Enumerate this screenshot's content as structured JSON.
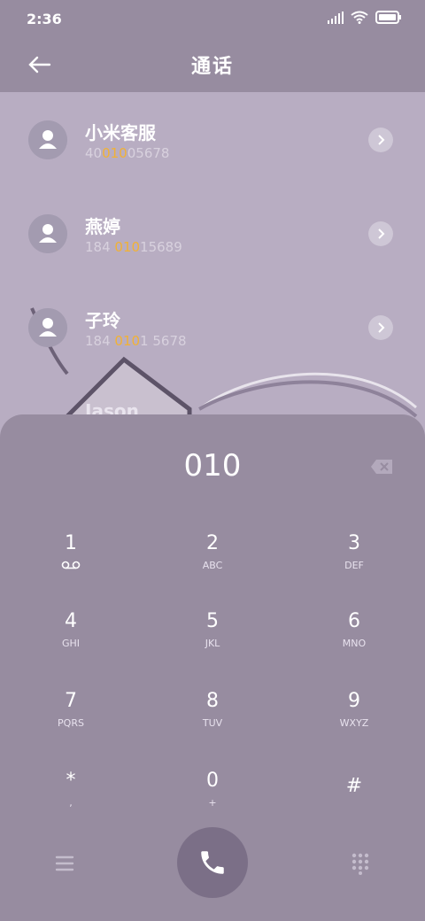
{
  "status": {
    "time": "2:36"
  },
  "header": {
    "title": "通话"
  },
  "contacts": [
    {
      "name": "小米客服",
      "num_pre": "40",
      "num_hl": "010",
      "num_post": "05678"
    },
    {
      "name": "燕婷",
      "num_pre": "184 ",
      "num_hl": "010",
      "num_post": "15689"
    },
    {
      "name": "子玲",
      "num_pre": "184 ",
      "num_hl": "010",
      "num_post": "1 5678"
    },
    {
      "name": "Jason",
      "num_pre": "",
      "num_hl": "",
      "num_post": ""
    }
  ],
  "dialer": {
    "value": "010",
    "keys": [
      {
        "digit": "1",
        "sub": ""
      },
      {
        "digit": "2",
        "sub": "ABC"
      },
      {
        "digit": "3",
        "sub": "DEF"
      },
      {
        "digit": "4",
        "sub": "GHI"
      },
      {
        "digit": "5",
        "sub": "JKL"
      },
      {
        "digit": "6",
        "sub": "MNO"
      },
      {
        "digit": "7",
        "sub": "PQRS"
      },
      {
        "digit": "8",
        "sub": "TUV"
      },
      {
        "digit": "9",
        "sub": "WXYZ"
      },
      {
        "digit": "*",
        "sub": ","
      },
      {
        "digit": "0",
        "sub": "+"
      },
      {
        "digit": "#",
        "sub": ""
      }
    ]
  },
  "icons": {
    "back": "arrow-left-icon",
    "delete": "backspace-icon",
    "menu": "menu-icon",
    "call": "phone-icon",
    "keypad": "dialpad-icon",
    "voicemail": "voicemail-icon"
  },
  "colors": {
    "highlight": "#f2b234",
    "panel": "#978ca0",
    "call_button": "#7b6f87"
  }
}
